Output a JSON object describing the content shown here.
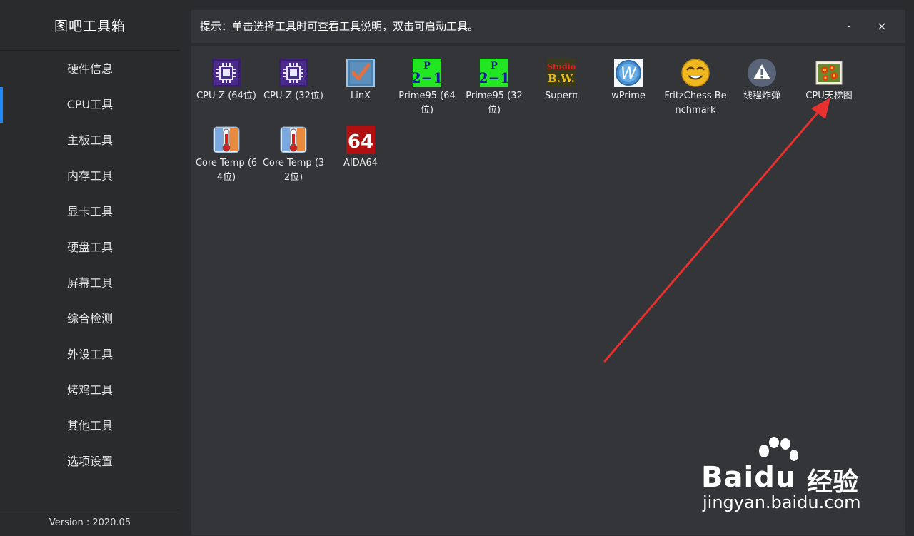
{
  "app": {
    "title": "图吧工具箱",
    "version": "Version : 2020.05"
  },
  "sidebar": {
    "items": [
      {
        "label": "硬件信息",
        "active": false
      },
      {
        "label": "CPU工具",
        "active": true
      },
      {
        "label": "主板工具",
        "active": false
      },
      {
        "label": "内存工具",
        "active": false
      },
      {
        "label": "显卡工具",
        "active": false
      },
      {
        "label": "硬盘工具",
        "active": false
      },
      {
        "label": "屏幕工具",
        "active": false
      },
      {
        "label": "综合检测",
        "active": false
      },
      {
        "label": "外设工具",
        "active": false
      },
      {
        "label": "烤鸡工具",
        "active": false
      },
      {
        "label": "其他工具",
        "active": false
      },
      {
        "label": "选项设置",
        "active": false
      }
    ]
  },
  "hint": {
    "text": "提示：单击选择工具时可查看工具说明，双击可启动工具。",
    "minimize": "-",
    "close": "×"
  },
  "tools": [
    {
      "label": "CPU-Z (64位)",
      "icon": "cpu-z-icon"
    },
    {
      "label": "CPU-Z (32位)",
      "icon": "cpu-z-icon"
    },
    {
      "label": "LinX",
      "icon": "linx-checkbox-icon"
    },
    {
      "label": "Prime95 (64位)",
      "icon": "prime95-icon",
      "icon_text": "2P-1"
    },
    {
      "label": "Prime95 (32位)",
      "icon": "prime95-icon",
      "icon_text": "2P-1"
    },
    {
      "label": "Superπ",
      "icon": "superpi-icon",
      "icon_text": "Studio B.W."
    },
    {
      "label": "wPrime",
      "icon": "wprime-icon",
      "icon_text": "W"
    },
    {
      "label": "FritzChess Benchmark",
      "icon": "fritz-smiley-icon"
    },
    {
      "label": "线程炸弹",
      "icon": "warning-icon",
      "icon_text": "!"
    },
    {
      "label": "CPU天梯图",
      "icon": "flower-image-icon"
    },
    {
      "label": "Core Temp (64位)",
      "icon": "thermometer-icon"
    },
    {
      "label": "Core Temp (32位)",
      "icon": "thermometer-icon"
    },
    {
      "label": "AIDA64",
      "icon": "aida64-icon",
      "icon_text": "64"
    }
  ],
  "watermark": {
    "brand": "Bai",
    "brand_du": "du",
    "brand_cn": "经验",
    "url": "jingyan.baidu.com"
  },
  "colors": {
    "accent": "#1e88ff",
    "arrow": "#e8312f",
    "background": "#2a2b2d",
    "panel": "#333538"
  }
}
